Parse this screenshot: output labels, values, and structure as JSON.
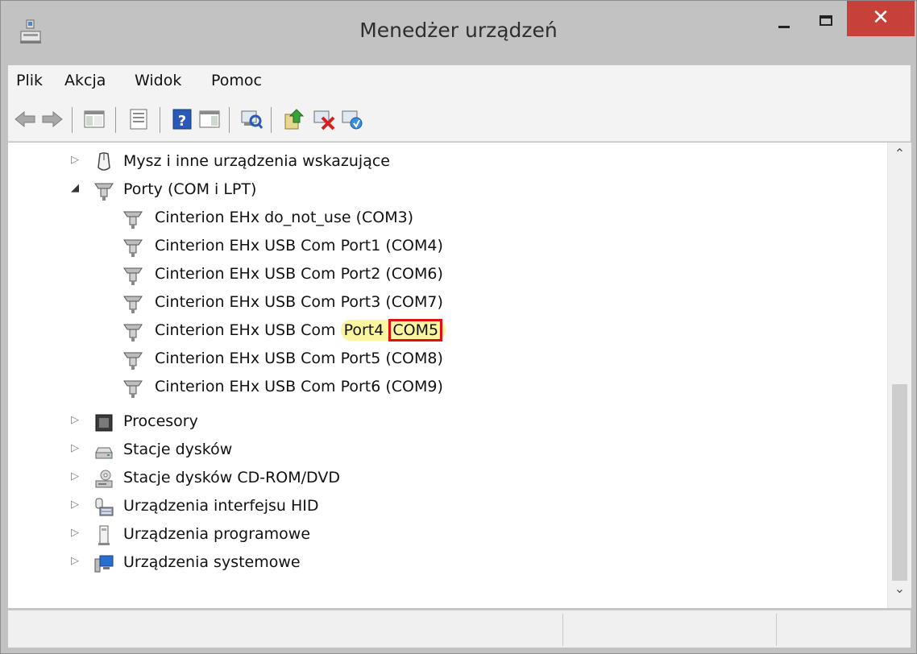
{
  "window": {
    "title": "Menedżer urządzeń",
    "close_glyph": "✕"
  },
  "menu": [
    "Plik",
    "Akcja",
    "Widok",
    "Pomoc"
  ],
  "toolbar_icons": [
    "back-arrow-icon",
    "forward-arrow-icon",
    "show-hide-console-tree-icon",
    "properties-icon",
    "help-icon",
    "action-pane-icon",
    "scan-hardware-changes-icon",
    "update-driver-icon",
    "uninstall-device-icon",
    "enable-device-icon"
  ],
  "tree": {
    "categories_top": [
      {
        "label": "Mysz i inne urządzenia wskazujące",
        "expanded": false,
        "icon": "mouse-icon"
      },
      {
        "label": "Porty (COM i LPT)",
        "expanded": true,
        "icon": "port-icon"
      }
    ],
    "ports": [
      {
        "label": "Cinterion EHx do_not_use (COM3)"
      },
      {
        "label": "Cinterion EHx USB Com Port1 (COM4)"
      },
      {
        "label": "Cinterion EHx USB Com Port2 (COM6)"
      },
      {
        "label": "Cinterion EHx USB Com Port3 (COM7)"
      },
      {
        "label_prefix": "Cinterion EHx USB Com ",
        "label_hl": "Port4 ",
        "label_box": "COM5",
        "label_suffix": ""
      },
      {
        "label": "Cinterion EHx USB Com Port5 (COM8)"
      },
      {
        "label": "Cinterion EHx USB Com Port6 (COM9)"
      }
    ],
    "categories_bottom": [
      {
        "label": "Procesory",
        "icon": "processor-icon"
      },
      {
        "label": "Stacje dysków",
        "icon": "disk-drive-icon"
      },
      {
        "label": "Stacje dysków CD-ROM/DVD",
        "icon": "cdrom-drive-icon"
      },
      {
        "label": "Urządzenia interfejsu HID",
        "icon": "hid-device-icon"
      },
      {
        "label": "Urządzenia programowe",
        "icon": "software-device-icon"
      },
      {
        "label": "Urządzenia systemowe",
        "icon": "system-device-icon"
      }
    ],
    "collapsed_glyph": "▷",
    "expanded_glyph": "◢"
  },
  "scrollbar": {
    "up_glyph": "⌃",
    "down_glyph": "⌄"
  },
  "colors": {
    "highlight": "#fbf59f",
    "red_box": "#e01010",
    "close_button": "#c7403a"
  }
}
